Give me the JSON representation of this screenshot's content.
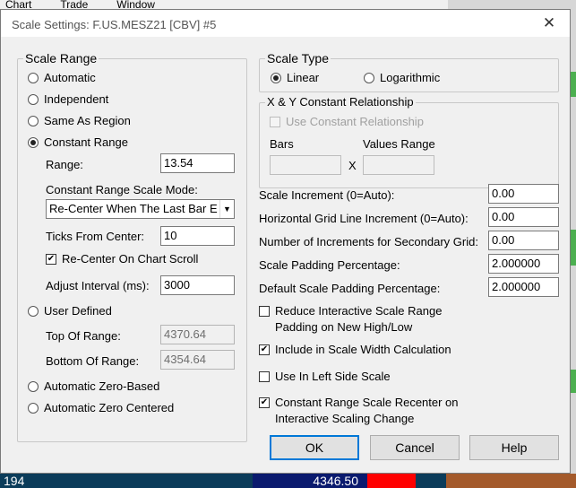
{
  "background": {
    "menu": [
      "Chart",
      "Trade",
      "Window"
    ],
    "status_left": "194",
    "status_price": "4346.50"
  },
  "dialog": {
    "title": "Scale Settings: F.US.MESZ21 [CBV]  #5",
    "close_glyph": "✕",
    "scale_range": {
      "legend": "Scale Range",
      "automatic": "Automatic",
      "independent": "Independent",
      "same_as_region": "Same As Region",
      "constant_range": "Constant Range",
      "range_label": "Range:",
      "range_value": "13.54",
      "mode_label": "Constant Range Scale Mode:",
      "mode_value": "Re-Center When The Last Bar E",
      "ticks_label": "Ticks From Center:",
      "ticks_value": "10",
      "recenter_scroll": "Re-Center On Chart Scroll",
      "adjust_label": "Adjust Interval (ms):",
      "adjust_value": "3000",
      "user_defined": "User Defined",
      "top_label": "Top Of Range:",
      "top_value": "4370.64",
      "bottom_label": "Bottom Of Range:",
      "bottom_value": "4354.64",
      "auto_zero_based": "Automatic Zero-Based",
      "auto_zero_centered": "Automatic Zero Centered",
      "selected": "constant_range"
    },
    "scale_type": {
      "legend": "Scale Type",
      "linear": "Linear",
      "logarithmic": "Logarithmic",
      "selected": "linear"
    },
    "xy": {
      "legend": "X & Y Constant Relationship",
      "use_constant": "Use Constant Relationship",
      "bars_label": "Bars",
      "values_label": "Values Range",
      "x_glyph": "X"
    },
    "fields": {
      "scale_increment_label": "Scale Increment (0=Auto):",
      "scale_increment_value": "0.00",
      "hgrid_label": "Horizontal Grid Line Increment (0=Auto):",
      "hgrid_value": "0.00",
      "secondary_label": "Number of Increments for Secondary Grid:",
      "secondary_value": "0.00",
      "padding_label": "Scale Padding Percentage:",
      "padding_value": "2.000000",
      "default_padding_label": "Default Scale Padding Percentage:",
      "default_padding_value": "2.000000"
    },
    "checks": {
      "reduce_line1": "Reduce Interactive Scale Range",
      "reduce_line2": "Padding on New High/Low",
      "include_width": "Include in Scale Width Calculation",
      "left_side": "Use In Left Side Scale",
      "recenter_line1": "Constant Range Scale Recenter on",
      "recenter_line2": "Interactive Scaling Change"
    },
    "buttons": {
      "ok": "OK",
      "cancel": "Cancel",
      "help": "Help"
    },
    "icons": {
      "dropdown": "▼",
      "check": "✔"
    }
  }
}
